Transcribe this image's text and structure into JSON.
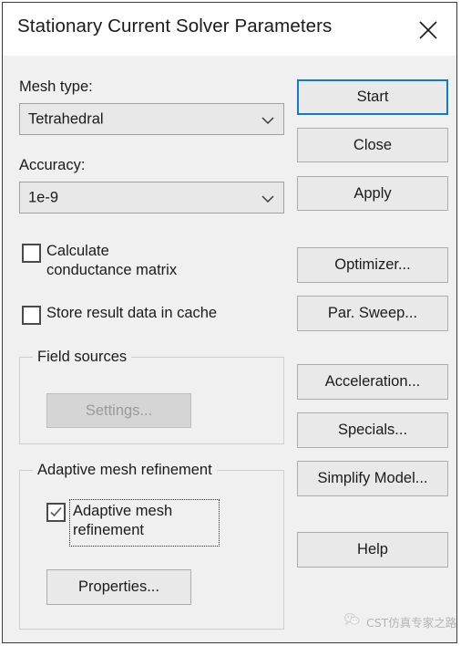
{
  "window": {
    "title": "Stationary Current Solver Parameters",
    "close_icon": "close-x-icon"
  },
  "form": {
    "mesh_type": {
      "label": "Mesh type:",
      "value": "Tetrahedral",
      "chevron_icon": "chevron-down-icon"
    },
    "accuracy": {
      "label": "Accuracy:",
      "value": "1e-9",
      "chevron_icon": "chevron-down-icon"
    },
    "checkboxes": [
      {
        "label": "Calculate\nconductance matrix",
        "line1": "Calculate",
        "line2": "conductance matrix",
        "checked": false
      },
      {
        "label": "Store result data in cache",
        "checked": false
      }
    ]
  },
  "field_sources": {
    "title": "Field sources",
    "settings_button": "Settings...",
    "settings_enabled": false
  },
  "adaptive": {
    "title": "Adaptive mesh refinement",
    "checkbox_line1": "Adaptive mesh",
    "checkbox_line2": "refinement",
    "checked": true,
    "check_icon": "check-icon",
    "properties_button": "Properties..."
  },
  "buttons": {
    "start": "Start",
    "close": "Close",
    "apply": "Apply",
    "optimizer": "Optimizer...",
    "par_sweep": "Par. Sweep...",
    "acceleration": "Acceleration...",
    "specials": "Specials...",
    "simplify_model": "Simplify Model...",
    "help": "Help"
  },
  "watermark": {
    "text": "CST仿真专家之路",
    "icon": "wechat-icon"
  },
  "colors": {
    "accent": "#0a7cd4",
    "dialog_bg": "#f0f0f0",
    "titlebar_bg": "#ffffff",
    "text": "#1b1b1b",
    "disabled_text": "#9a9a9a"
  }
}
